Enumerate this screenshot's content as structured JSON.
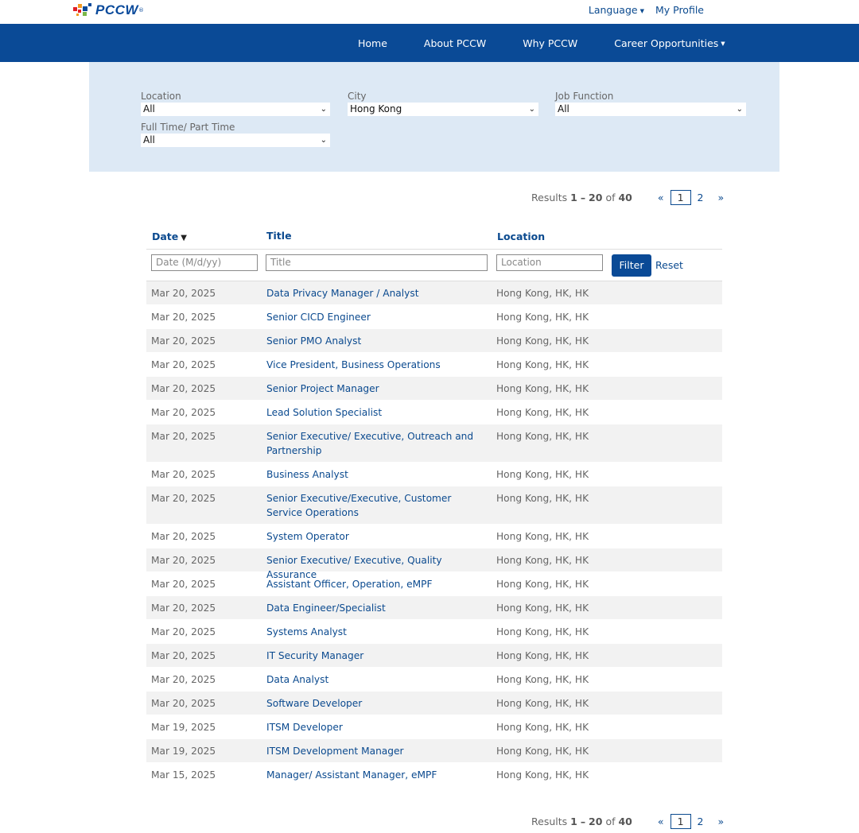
{
  "brand": {
    "logo_text": "PCCW"
  },
  "utility_nav": {
    "language": "Language",
    "my_profile": "My Profile"
  },
  "main_nav": {
    "items": [
      "Home",
      "About PCCW",
      "Why PCCW",
      "Career Opportunities"
    ]
  },
  "filters": {
    "location": {
      "label": "Location",
      "value": "All"
    },
    "city": {
      "label": "City",
      "value": "Hong Kong"
    },
    "job_function": {
      "label": "Job Function",
      "value": "All"
    },
    "employment_type": {
      "label": "Full Time/ Part Time",
      "value": "All"
    }
  },
  "pagination": {
    "results_prefix": "Results",
    "range_start": "1",
    "range_sep": "–",
    "range_end": "20",
    "of_label": "of",
    "total": "40",
    "prev": "«",
    "current_page": "1",
    "next_page": "2",
    "next": "»"
  },
  "table": {
    "headers": {
      "date": "Date",
      "title": "Title",
      "location": "Location"
    },
    "filter_row": {
      "date_placeholder": "Date (M/d/yy)",
      "title_placeholder": "Title",
      "location_placeholder": "Location",
      "filter_button": "Filter",
      "reset_link": "Reset"
    },
    "rows": [
      {
        "date": "Mar 20, 2025",
        "title": "Data Privacy Manager / Analyst",
        "location": "Hong Kong, HK, HK"
      },
      {
        "date": "Mar 20, 2025",
        "title": "Senior CICD Engineer",
        "location": "Hong Kong, HK, HK"
      },
      {
        "date": "Mar 20, 2025",
        "title": "Senior PMO Analyst",
        "location": "Hong Kong, HK, HK"
      },
      {
        "date": "Mar 20, 2025",
        "title": "Vice President, Business Operations",
        "location": "Hong Kong, HK, HK"
      },
      {
        "date": "Mar 20, 2025",
        "title": "Senior Project Manager",
        "location": "Hong Kong, HK, HK"
      },
      {
        "date": "Mar 20, 2025",
        "title": "Lead Solution Specialist",
        "location": "Hong Kong, HK, HK"
      },
      {
        "date": "Mar 20, 2025",
        "title": "Senior Executive/ Executive, Outreach and Partnership",
        "location": "Hong Kong, HK, HK"
      },
      {
        "date": "Mar 20, 2025",
        "title": "Business Analyst",
        "location": "Hong Kong, HK, HK"
      },
      {
        "date": "Mar 20, 2025",
        "title": "Senior Executive/Executive, Customer Service Operations",
        "location": "Hong Kong, HK, HK"
      },
      {
        "date": "Mar 20, 2025",
        "title": "System Operator",
        "location": "Hong Kong, HK, HK"
      },
      {
        "date": "Mar 20, 2025",
        "title": "Senior Executive/ Executive, Quality Assurance",
        "location": "Hong Kong, HK, HK"
      },
      {
        "date": "Mar 20, 2025",
        "title": "Assistant Officer, Operation, eMPF",
        "location": "Hong Kong, HK, HK"
      },
      {
        "date": "Mar 20, 2025",
        "title": "Data Engineer/Specialist",
        "location": "Hong Kong, HK, HK"
      },
      {
        "date": "Mar 20, 2025",
        "title": "Systems Analyst",
        "location": "Hong Kong, HK, HK"
      },
      {
        "date": "Mar 20, 2025",
        "title": "IT Security Manager",
        "location": "Hong Kong, HK, HK"
      },
      {
        "date": "Mar 20, 2025",
        "title": "Data Analyst",
        "location": "Hong Kong, HK, HK"
      },
      {
        "date": "Mar 20, 2025",
        "title": "Software Developer",
        "location": "Hong Kong, HK, HK"
      },
      {
        "date": "Mar 19, 2025",
        "title": "ITSM Developer",
        "location": "Hong Kong, HK, HK"
      },
      {
        "date": "Mar 19, 2025",
        "title": "ITSM Development Manager",
        "location": "Hong Kong, HK, HK"
      },
      {
        "date": "Mar 15, 2025",
        "title": "Manager/ Assistant Manager, eMPF",
        "location": "Hong Kong, HK, HK"
      }
    ]
  },
  "colors": {
    "nav_blue": "#0a4a96",
    "link_blue": "#0b4a8f",
    "filter_panel": "#dde9f5",
    "row_stripe": "#f2f2f2"
  },
  "icons": {
    "dropdown": "chevron-down-icon",
    "sort": "sort-desc-icon",
    "logo": "pccw-pixel-logo-icon"
  }
}
